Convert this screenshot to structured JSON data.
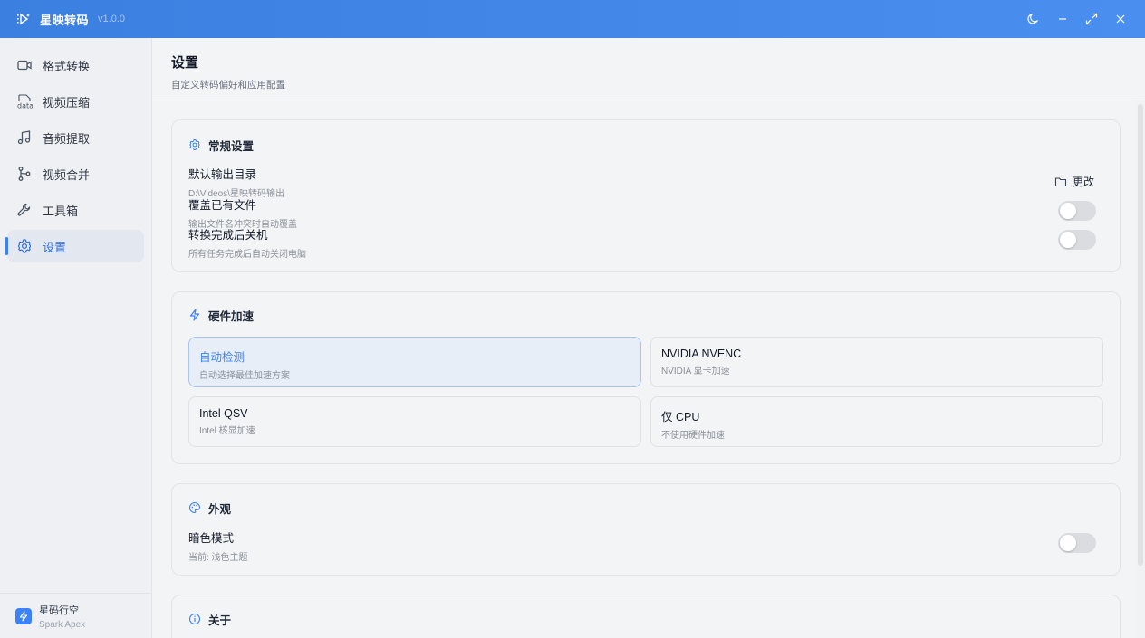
{
  "app": {
    "title": "星映转码",
    "version": "v1.0.0",
    "logo_icon": "play-sparkle-icon"
  },
  "window_controls": [
    {
      "name": "theme-toggle-button",
      "icon": "moon-icon"
    },
    {
      "name": "minimize-button",
      "icon": "minus-icon"
    },
    {
      "name": "maximize-button",
      "icon": "expand-icon"
    },
    {
      "name": "close-button",
      "icon": "close-icon"
    }
  ],
  "sidebar": {
    "items": [
      {
        "label": "格式转换",
        "icon": "video-icon",
        "active": false
      },
      {
        "label": "视频压缩",
        "icon": "data-icon",
        "icon_text": "data",
        "active": false
      },
      {
        "label": "音频提取",
        "icon": "music-icon",
        "active": false
      },
      {
        "label": "视频合并",
        "icon": "merge-icon",
        "active": false
      },
      {
        "label": "工具箱",
        "icon": "wrench-icon",
        "active": false
      },
      {
        "label": "设置",
        "icon": "gear-icon",
        "active": true
      }
    ],
    "brand": {
      "name": "星码行空",
      "sub": "Spark Apex"
    }
  },
  "page": {
    "title": "设置",
    "subtitle": "自定义转码偏好和应用配置"
  },
  "general": {
    "title": "常规设置",
    "output_dir": {
      "label": "默认输出目录",
      "value": "D:\\Videos\\星映转码输出",
      "button": "更改"
    },
    "overwrite": {
      "label": "覆盖已有文件",
      "desc": "输出文件名冲突时自动覆盖",
      "enabled": false
    },
    "shutdown": {
      "label": "转换完成后关机",
      "desc": "所有任务完成后自动关闭电脑",
      "enabled": false
    }
  },
  "hardware": {
    "title": "硬件加速",
    "options": [
      {
        "name": "自动检测",
        "desc": "自动选择最佳加速方案",
        "selected": true
      },
      {
        "name": "NVIDIA NVENC",
        "desc": "NVIDIA 显卡加速",
        "selected": false
      },
      {
        "name": "Intel QSV",
        "desc": "Intel 核显加速",
        "selected": false
      },
      {
        "name": "仅 CPU",
        "desc": "不使用硬件加速",
        "selected": false
      }
    ]
  },
  "appearance": {
    "title": "外观",
    "dark_mode": {
      "label": "暗色模式",
      "desc": "当前: 浅色主题",
      "enabled": false
    }
  },
  "about": {
    "title": "关于"
  },
  "colors": {
    "accent": "#3b82f6",
    "titlebar": "#3b7fe0"
  }
}
